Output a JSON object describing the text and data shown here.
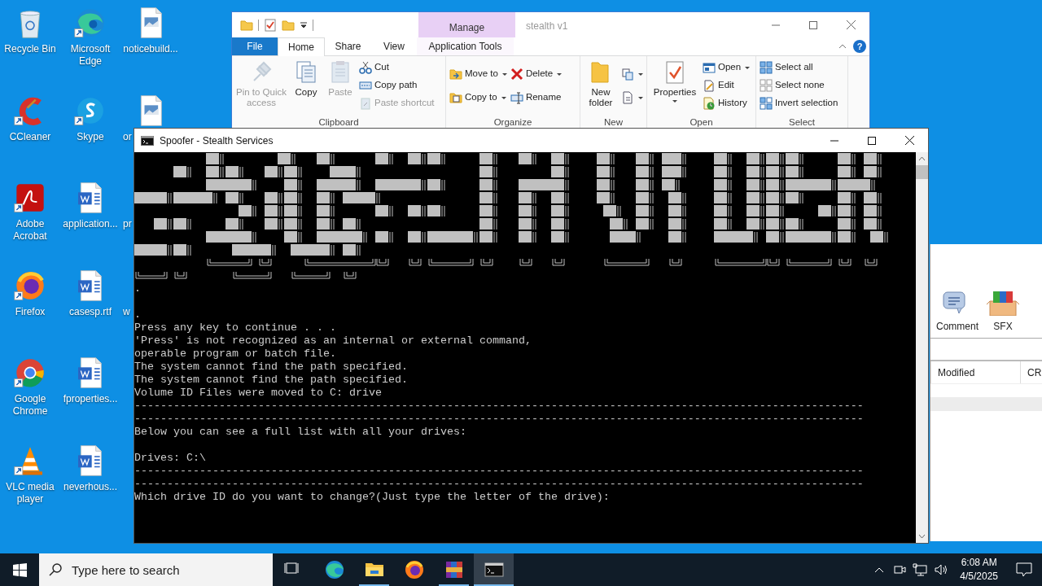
{
  "desktop": {
    "icons": [
      {
        "label": "Recycle Bin",
        "cut": false
      },
      {
        "label": "CCleaner",
        "cut": false
      },
      {
        "label": "Adobe Acrobat",
        "cut": false
      },
      {
        "label": "Firefox",
        "cut": false
      },
      {
        "label": "Google Chrome",
        "cut": false
      },
      {
        "label": "VLC media player",
        "cut": false
      },
      {
        "label": "Microsoft Edge",
        "cut": false
      },
      {
        "label": "Skype",
        "cut": false
      },
      {
        "label": "application...",
        "cut": false
      },
      {
        "label": "casesp.rtf",
        "cut": false
      },
      {
        "label": "fproperties...",
        "cut": false
      },
      {
        "label": "neverhous...",
        "cut": false
      },
      {
        "label": "noticebuild...",
        "cut": false
      },
      {
        "label": "or",
        "cut": true
      },
      {
        "label": "pr",
        "cut": true
      },
      {
        "label": "w",
        "cut": true
      }
    ]
  },
  "explorer": {
    "title": "stealth v1",
    "context_tab": "Manage",
    "tabs": [
      {
        "label": "File",
        "selected": false
      },
      {
        "label": "Home",
        "selected": true
      },
      {
        "label": "Share",
        "selected": false
      },
      {
        "label": "View",
        "selected": false
      },
      {
        "label": "Application Tools",
        "selected": false
      }
    ],
    "help_button": "?",
    "ribbon": [
      {
        "label": "Clipboard",
        "columns": [
          {
            "kind": "large",
            "label": "Pin to Quick access",
            "disabled": true,
            "dropdown": false
          },
          {
            "kind": "large",
            "label": "Copy",
            "disabled": false,
            "dropdown": false
          },
          {
            "kind": "large",
            "label": "Paste",
            "disabled": true,
            "dropdown": false
          },
          {
            "kind": "stack",
            "items": [
              {
                "label": "Cut",
                "disabled": false,
                "dropdown": false
              },
              {
                "label": "Copy path",
                "disabled": false,
                "dropdown": false
              },
              {
                "label": "Paste shortcut",
                "disabled": true,
                "dropdown": false
              }
            ]
          }
        ]
      },
      {
        "label": "Organize",
        "columns": [
          {
            "kind": "stack",
            "items": [
              {
                "label": "Move to",
                "disabled": false,
                "dropdown": true
              },
              {
                "label": "Copy to",
                "disabled": false,
                "dropdown": true
              }
            ]
          },
          {
            "kind": "stack",
            "items": [
              {
                "label": "Delete",
                "disabled": false,
                "dropdown": true
              },
              {
                "label": "Rename",
                "disabled": false,
                "dropdown": false
              }
            ]
          }
        ]
      },
      {
        "label": "New",
        "columns": [
          {
            "kind": "large",
            "label": "New folder",
            "disabled": false,
            "dropdown": false
          },
          {
            "kind": "stack",
            "items": [
              {
                "disabled": false,
                "dropdown": true
              },
              {
                "disabled": false,
                "dropdown": true
              }
            ]
          }
        ]
      },
      {
        "label": "Open",
        "columns": [
          {
            "kind": "large",
            "label": "Properties",
            "disabled": false,
            "dropdown": true
          },
          {
            "kind": "stack",
            "items": [
              {
                "label": "Open",
                "disabled": false,
                "dropdown": true
              },
              {
                "label": "Edit",
                "disabled": false,
                "dropdown": false
              },
              {
                "label": "History",
                "disabled": false,
                "dropdown": false
              }
            ]
          }
        ]
      },
      {
        "label": "Select",
        "columns": [
          {
            "kind": "stack",
            "items": [
              {
                "label": "Select all",
                "disabled": false,
                "dropdown": false
              },
              {
                "label": "Select none",
                "disabled": false,
                "dropdown": false
              },
              {
                "label": "Invert selection",
                "disabled": false,
                "dropdown": false
              }
            ]
          }
        ]
      }
    ]
  },
  "console": {
    "title": "Spoofer - Stealth Services",
    "paragraphs": [
      [
        "."
      ],
      [
        ".",
        "Press any key to continue . . .",
        "'Press' is not recognized as an internal or external command,",
        "operable program or batch file.",
        "The system cannot find the path specified.",
        "The system cannot find the path specified.",
        "Volume ID Files were moved to C: drive",
        "----------------------------------------------------------------------------------------------------------------",
        "----------------------------------------------------------------------------------------------------------------",
        "Below you can see a full list with all your drives:"
      ],
      [
        "Drives: C:\\",
        "----------------------------------------------------------------------------------------------------------------",
        "----------------------------------------------------------------------------------------------------------------",
        "Which drive ID do you want to change?(Just type the letter of the drive):"
      ]
    ]
  },
  "winrar": {
    "toolbar": [
      "Comment",
      "SFX"
    ],
    "columns": [
      "Modified",
      "CR"
    ]
  },
  "taskbar": {
    "search": {
      "placeholder": "Type here to search"
    },
    "apps": [
      {
        "running": false,
        "active": false
      },
      {
        "running": false,
        "active": false
      },
      {
        "running": true,
        "active": false
      },
      {
        "running": false,
        "active": false
      },
      {
        "running": true,
        "active": false
      },
      {
        "running": true,
        "active": true
      }
    ],
    "clock": {
      "time": "6:08 AM",
      "date": "4/5/2025"
    }
  }
}
